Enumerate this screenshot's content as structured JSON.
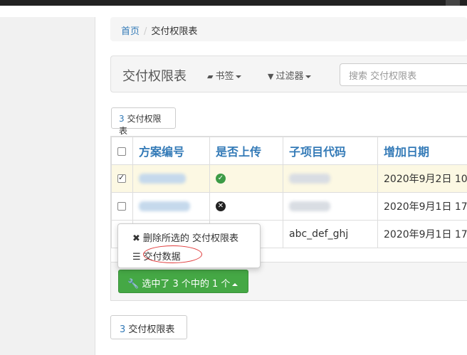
{
  "breadcrumb": {
    "home": "首页",
    "current": "交付权限表"
  },
  "header": {
    "title": "交付权限表",
    "bookmarks_label": "书签",
    "filters_label": "过滤器",
    "search_placeholder": "搜索 交付权限表"
  },
  "count_top": {
    "num": "3",
    "label": "交付权限表"
  },
  "table": {
    "columns": [
      "方案编号",
      "是否上传",
      "子项目代码",
      "增加日期"
    ],
    "rows": [
      {
        "selected": true,
        "uploaded": true,
        "code": "",
        "date": "2020年9月2日 10"
      },
      {
        "selected": false,
        "uploaded": false,
        "code": "",
        "date": "2020年9月1日 17"
      },
      {
        "selected": false,
        "uploaded": null,
        "code": "abc_def_ghj",
        "date": "2020年9月1日 17"
      }
    ]
  },
  "dropdown": {
    "delete_label": "删除所选的 交付权限表",
    "deliver_label": "交付数据"
  },
  "action_button": {
    "label": "选中了 3 个中的 1 个"
  },
  "count_bottom": {
    "num": "3",
    "label": "交付权限表"
  },
  "colors": {
    "primary": "#337ab7",
    "success": "#45a845",
    "selected_row": "#fcf8e3",
    "annotation": "#e03a3a"
  },
  "icons": [
    "book-icon",
    "filter-icon",
    "check-circle-icon",
    "times-circle-icon",
    "remove-icon",
    "list-icon",
    "wrench-icon"
  ]
}
